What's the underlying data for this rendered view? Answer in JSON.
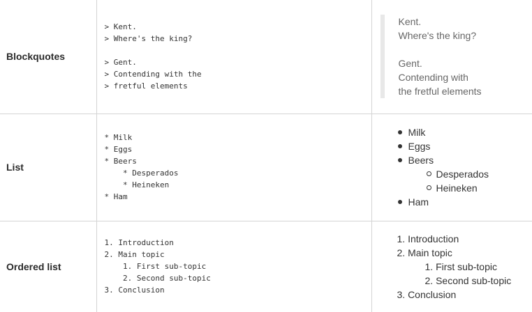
{
  "rows": {
    "blockquotes": {
      "label": "Blockquotes",
      "source": [
        "> Kent.",
        "> Where's the king?",
        "",
        "> Gent.",
        "> Contending with the",
        "> fretful elements"
      ],
      "rendered": {
        "q1": [
          "Kent.",
          "Where's the king?"
        ],
        "q2": [
          "Gent.",
          "Contending with",
          "the fretful elements"
        ]
      }
    },
    "list": {
      "label": "List",
      "source": [
        "* Milk",
        "* Eggs",
        "* Beers",
        "    * Desperados",
        "    * Heineken",
        "* Ham"
      ],
      "rendered": {
        "items": [
          "Milk",
          "Eggs",
          "Beers",
          "Ham"
        ],
        "sub_items": [
          "Desperados",
          "Heineken"
        ]
      }
    },
    "ordered_list": {
      "label": "Ordered list",
      "source": [
        "1. Introduction",
        "2. Main topic",
        "    1. First sub-topic",
        "    2. Second sub-topic",
        "3. Conclusion"
      ],
      "rendered": {
        "items": [
          "1. Introduction",
          "2. Main topic",
          "3. Conclusion"
        ],
        "sub_items": [
          "1. First sub-topic",
          "2. Second sub-topic"
        ]
      }
    }
  }
}
